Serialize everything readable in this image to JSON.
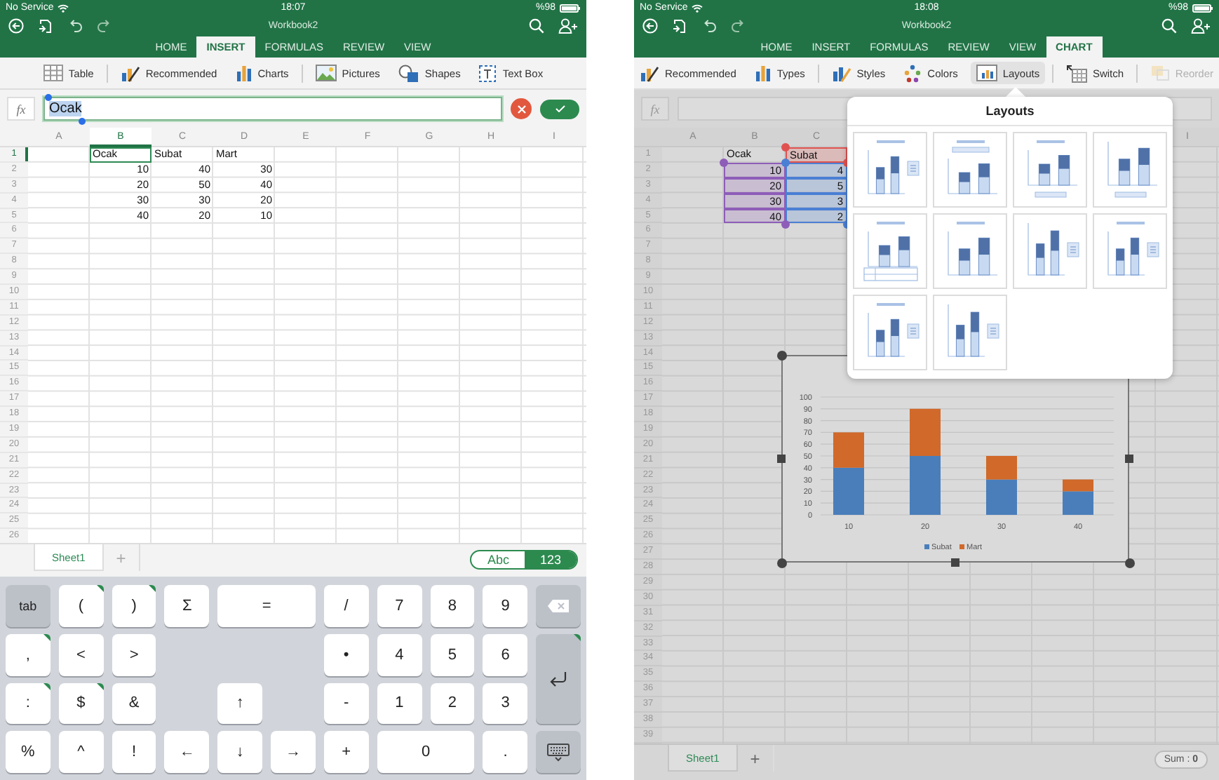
{
  "screens": [
    {
      "status_bar": {
        "carrier": "No Service",
        "time": "18:07",
        "battery": "%98"
      },
      "title": "Workbook2",
      "tabs": [
        {
          "label": "HOME",
          "selected": false
        },
        {
          "label": "INSERT",
          "selected": true
        },
        {
          "label": "FORMULAS",
          "selected": false
        },
        {
          "label": "REVIEW",
          "selected": false
        },
        {
          "label": "VIEW",
          "selected": false
        }
      ],
      "ribbon": [
        [
          {
            "label": "Table"
          }
        ],
        [
          {
            "label": "Recommended"
          },
          {
            "label": "Charts"
          }
        ],
        [
          {
            "label": "Pictures"
          },
          {
            "label": "Shapes"
          },
          {
            "label": "Text Box"
          }
        ]
      ],
      "formula_bar": {
        "label": "fx",
        "value": "Ocak",
        "editing": true
      },
      "sheet": {
        "columns": [
          {
            "label": "A",
            "selected": false
          },
          {
            "label": "B",
            "selected": true,
            "cells": [
              {
                "text": "Ocak",
                "kind": "text",
                "selected": true
              },
              {
                "text": "10",
                "kind": "number",
                "selected": false
              },
              {
                "text": "20",
                "kind": "number",
                "selected": false
              },
              {
                "text": "30",
                "kind": "number",
                "selected": false
              },
              {
                "text": "40",
                "kind": "number",
                "selected": false
              }
            ]
          },
          {
            "label": "C",
            "selected": false,
            "cells": [
              {
                "text": "Subat",
                "kind": "text",
                "selected": false
              },
              {
                "text": "40",
                "kind": "number",
                "selected": false
              },
              {
                "text": "50",
                "kind": "number",
                "selected": false
              },
              {
                "text": "30",
                "kind": "number",
                "selected": false
              },
              {
                "text": "20",
                "kind": "number",
                "selected": false
              }
            ]
          },
          {
            "label": "D",
            "selected": false,
            "cells": [
              {
                "text": "Mart",
                "kind": "text",
                "selected": false
              },
              {
                "text": "30",
                "kind": "number",
                "selected": false
              },
              {
                "text": "40",
                "kind": "number",
                "selected": false
              },
              {
                "text": "20",
                "kind": "number",
                "selected": false
              },
              {
                "text": "10",
                "kind": "number",
                "selected": false
              }
            ]
          },
          {
            "label": "E",
            "selected": false
          },
          {
            "label": "F",
            "selected": false
          },
          {
            "label": "G",
            "selected": false
          },
          {
            "label": "H",
            "selected": false
          },
          {
            "label": "I",
            "selected": false
          }
        ],
        "rows": [
          {
            "label": "1",
            "selected": true
          },
          {
            "label": "2",
            "selected": false
          },
          {
            "label": "3",
            "selected": false
          },
          {
            "label": "4",
            "selected": false
          },
          {
            "label": "5",
            "selected": false
          },
          {
            "label": "6",
            "selected": false
          },
          {
            "label": "7",
            "selected": false
          },
          {
            "label": "8",
            "selected": false
          },
          {
            "label": "9",
            "selected": false
          },
          {
            "label": "10",
            "selected": false
          },
          {
            "label": "11",
            "selected": false
          },
          {
            "label": "12",
            "selected": false
          },
          {
            "label": "13",
            "selected": false
          },
          {
            "label": "14",
            "selected": false
          },
          {
            "label": "15",
            "selected": false
          },
          {
            "label": "16",
            "selected": false
          },
          {
            "label": "17",
            "selected": false
          },
          {
            "label": "18",
            "selected": false
          },
          {
            "label": "19",
            "selected": false
          },
          {
            "label": "20",
            "selected": false
          },
          {
            "label": "21",
            "selected": false
          },
          {
            "label": "22",
            "selected": false
          },
          {
            "label": "23",
            "selected": false
          },
          {
            "label": "24",
            "selected": false
          },
          {
            "label": "25",
            "selected": false
          },
          {
            "label": "26",
            "selected": false
          }
        ]
      },
      "sheet_tabs": [
        {
          "label": "Sheet1",
          "selected": true
        }
      ],
      "add_sheet": "+",
      "input_toggle": [
        {
          "label": "Abc",
          "selected": false
        },
        {
          "label": "123",
          "selected": true
        }
      ],
      "keyboard": [
        {
          "label": "tab",
          "kind": "action",
          "hint": false
        },
        {
          "label": "(",
          "kind": "key",
          "hint": true
        },
        {
          "label": ")",
          "kind": "key",
          "hint": true
        },
        {
          "label": "Σ",
          "kind": "key",
          "hint": false
        },
        {
          "label": "=",
          "kind": "wide",
          "hint": false
        },
        {
          "label": "/",
          "kind": "key",
          "hint": false
        },
        {
          "label": "7",
          "kind": "key",
          "hint": false
        },
        {
          "label": "8",
          "kind": "key",
          "hint": false
        },
        {
          "label": "9",
          "kind": "key",
          "hint": false
        },
        {
          "kind": "backspace",
          "hint": false
        },
        {
          "label": ",",
          "kind": "key",
          "hint": true
        },
        {
          "label": "<",
          "kind": "key",
          "hint": false
        },
        {
          "label": ">",
          "kind": "key",
          "hint": false
        },
        {
          "kind": "blank"
        },
        {
          "kind": "blank"
        },
        {
          "kind": "blank"
        },
        {
          "label": "•",
          "kind": "key",
          "hint": false
        },
        {
          "label": "4",
          "kind": "key",
          "hint": false
        },
        {
          "label": "5",
          "kind": "key",
          "hint": false
        },
        {
          "label": "6",
          "kind": "key",
          "hint": false
        },
        {
          "kind": "return",
          "hint": true
        },
        {
          "label": ":",
          "kind": "key",
          "hint": true
        },
        {
          "label": "$",
          "kind": "key",
          "hint": true
        },
        {
          "label": "&",
          "kind": "key",
          "hint": false
        },
        {
          "kind": "blank"
        },
        {
          "label": "↑",
          "kind": "key",
          "hint": false
        },
        {
          "kind": "blank"
        },
        {
          "label": "-",
          "kind": "key",
          "hint": false
        },
        {
          "label": "1",
          "kind": "key",
          "hint": false
        },
        {
          "label": "2",
          "kind": "key",
          "hint": false
        },
        {
          "label": "3",
          "kind": "key",
          "hint": false
        },
        {
          "label": "%",
          "kind": "key",
          "hint": false
        },
        {
          "label": "^",
          "kind": "key",
          "hint": false
        },
        {
          "label": "!",
          "kind": "key",
          "hint": false
        },
        {
          "label": "←",
          "kind": "key",
          "hint": false
        },
        {
          "label": "↓",
          "kind": "key",
          "hint": false
        },
        {
          "label": "→",
          "kind": "key",
          "hint": false
        },
        {
          "label": "+",
          "kind": "key",
          "hint": false
        },
        {
          "label": "0",
          "kind": "wide",
          "hint": false
        },
        {
          "label": ".",
          "kind": "key",
          "hint": false
        },
        {
          "kind": "hide",
          "hint": false
        }
      ]
    },
    {
      "status_bar": {
        "carrier": "No Service",
        "time": "18:08",
        "battery": "%98"
      },
      "title": "Workbook2",
      "tabs": [
        {
          "label": "HOME",
          "selected": false
        },
        {
          "label": "INSERT",
          "selected": false
        },
        {
          "label": "FORMULAS",
          "selected": false
        },
        {
          "label": "REVIEW",
          "selected": false
        },
        {
          "label": "VIEW",
          "selected": false
        },
        {
          "label": "CHART",
          "selected": true
        }
      ],
      "ribbon": [
        [
          {
            "label": "Recommended",
            "open": false,
            "disabled": false
          },
          {
            "label": "Types",
            "open": false,
            "disabled": false
          }
        ],
        [
          {
            "label": "Styles",
            "open": false,
            "disabled": false
          },
          {
            "label": "Colors",
            "open": false,
            "disabled": false
          },
          {
            "label": "Layouts",
            "open": true,
            "disabled": false
          }
        ],
        [
          {
            "label": "Switch",
            "open": false,
            "disabled": false
          }
        ],
        [
          {
            "label": "Reorder",
            "open": false,
            "disabled": true
          }
        ]
      ],
      "formula_bar": {
        "label": "fx",
        "editing": false
      },
      "sheet": {
        "columns": [
          {
            "label": "A",
            "selected": false
          },
          {
            "label": "B",
            "selected": false,
            "cells": [
              {
                "text": "Ocak",
                "kind": "text",
                "selected": false
              },
              {
                "text": "10",
                "kind": "number",
                "selected": false,
                "color": "#8e5db8"
              },
              {
                "text": "20",
                "kind": "number",
                "selected": false,
                "color": "#8e5db8"
              },
              {
                "text": "30",
                "kind": "number",
                "selected": false,
                "color": "#8e5db8"
              },
              {
                "text": "40",
                "kind": "number",
                "selected": false,
                "color": "#8e5db8"
              }
            ]
          },
          {
            "label": "C",
            "selected": false,
            "cells": [
              {
                "text": "Subat",
                "kind": "text",
                "selected": false,
                "color": "#e0524f"
              },
              {
                "text": "4",
                "kind": "number",
                "selected": false,
                "color": "#4a7fd4"
              },
              {
                "text": "5",
                "kind": "number",
                "selected": false,
                "color": "#4a7fd4"
              },
              {
                "text": "3",
                "kind": "number",
                "selected": false,
                "color": "#4a7fd4"
              },
              {
                "text": "2",
                "kind": "number",
                "selected": false,
                "color": "#4a7fd4"
              }
            ]
          },
          {},
          {},
          {},
          {},
          {},
          {
            "label": "I",
            "selected": false
          }
        ],
        "rows": [
          {
            "label": "1",
            "selected": false
          },
          {
            "label": "2",
            "selected": false
          },
          {
            "label": "3",
            "selected": false
          },
          {
            "label": "4",
            "selected": false
          },
          {
            "label": "5",
            "selected": false
          },
          {
            "label": "6",
            "selected": false
          },
          {
            "label": "7",
            "selected": false
          },
          {
            "label": "8",
            "selected": false
          },
          {
            "label": "9",
            "selected": false
          },
          {
            "label": "10",
            "selected": false
          },
          {
            "label": "11",
            "selected": false
          },
          {
            "label": "12",
            "selected": false
          },
          {
            "label": "13",
            "selected": false
          },
          {
            "label": "14",
            "selected": false
          },
          {
            "label": "15",
            "selected": false
          },
          {
            "label": "16",
            "selected": false
          },
          {
            "label": "17",
            "selected": false
          },
          {
            "label": "18",
            "selected": false
          },
          {
            "label": "19",
            "selected": false
          },
          {
            "label": "20",
            "selected": false
          },
          {
            "label": "21",
            "selected": false
          },
          {
            "label": "22",
            "selected": false
          },
          {
            "label": "23",
            "selected": false
          },
          {
            "label": "24",
            "selected": false
          },
          {
            "label": "25",
            "selected": false
          },
          {
            "label": "26",
            "selected": false
          },
          {
            "label": "27",
            "selected": false
          },
          {
            "label": "28",
            "selected": false
          },
          {
            "label": "29",
            "selected": false
          },
          {
            "label": "30",
            "selected": false
          },
          {
            "label": "31",
            "selected": false
          },
          {
            "label": "32",
            "selected": false
          },
          {
            "label": "33",
            "selected": false
          },
          {
            "label": "34",
            "selected": false
          },
          {
            "label": "35",
            "selected": false
          },
          {
            "label": "36",
            "selected": false
          },
          {
            "label": "37",
            "selected": false
          },
          {
            "label": "38",
            "selected": false
          },
          {
            "label": "39",
            "selected": false
          }
        ]
      },
      "chart": {
        "chart_data": {
          "type": "bar",
          "stacked": true,
          "categories": [
            "10",
            "20",
            "30",
            "40"
          ],
          "series": [
            {
              "name": "Subat",
              "color": "#4a7ebb",
              "values": [
                40,
                50,
                30,
                20
              ]
            },
            {
              "name": "Mart",
              "color": "#d0692a",
              "values": [
                30,
                40,
                20,
                10
              ]
            }
          ],
          "ylim": [
            0,
            100
          ],
          "yticks": [
            0,
            10,
            20,
            30,
            40,
            50,
            60,
            70,
            80,
            90,
            100
          ],
          "grid": true,
          "legend": "bottom"
        }
      },
      "popover": {
        "title": "Layouts",
        "options": [
          {
            "title": true,
            "kind": "legend-right",
            "table": false
          },
          {
            "title": true,
            "kind": "legend-top",
            "table": false
          },
          {
            "title": true,
            "kind": "legend-bottom",
            "table": false
          },
          {
            "title": false,
            "kind": "legend-bottom",
            "table": false
          },
          {
            "title": true,
            "kind": "no-legend",
            "table": true
          },
          {
            "title": true,
            "kind": "no-legend",
            "table": false
          },
          {
            "title": false,
            "kind": "legend-right",
            "table": false
          },
          {
            "title": true,
            "kind": "legend-right",
            "table": false
          },
          {
            "title": true,
            "kind": "legend-right",
            "table": false
          },
          {
            "title": false,
            "kind": "legend-right",
            "table": false
          }
        ]
      },
      "sheet_tabs": [
        {
          "label": "Sheet1",
          "selected": true
        }
      ],
      "add_sheet": "+",
      "sum": "Sum : **0**"
    }
  ]
}
